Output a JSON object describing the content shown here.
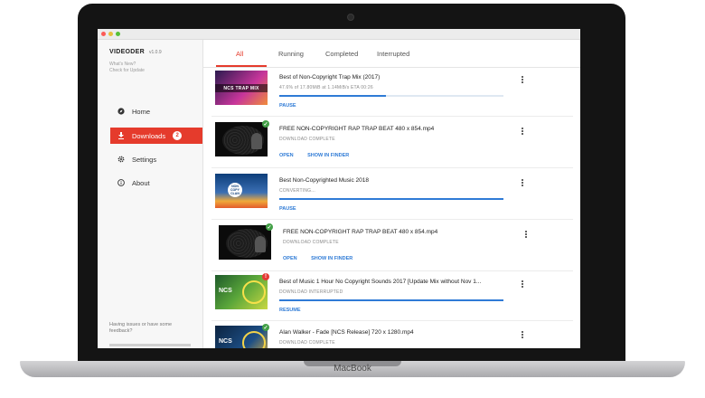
{
  "app": {
    "name": "VIDEODER",
    "version": "v1.0.9",
    "whats_new": "What's New?",
    "check_updates": "Check for Update"
  },
  "sidebar": {
    "items": [
      {
        "label": "Home",
        "icon": "compass-icon"
      },
      {
        "label": "Downloads",
        "icon": "download-icon",
        "badge": "2"
      },
      {
        "label": "Settings",
        "icon": "gear-icon"
      },
      {
        "label": "About",
        "icon": "info-icon"
      }
    ],
    "feedback": "Having issues or have some feedback?"
  },
  "tabs": [
    "All",
    "Running",
    "Completed",
    "Interrupted"
  ],
  "downloads": [
    {
      "title": "Best of Non-Copyright Trap Mix (2017)",
      "status": "47.6% of 17.80MiB at 1.14MiB/s ETA 00:26",
      "progress": 0.476,
      "actions": [
        "PAUSE"
      ],
      "thumb_text": "NCS TRAP MIX",
      "state": "running"
    },
    {
      "title": "FREE NON-COPYRIGHT RAP TRAP BEAT 480 x 854.mp4",
      "status": "DOWNLOAD COMPLETE",
      "actions": [
        "OPEN",
        "SHOW IN FINDER"
      ],
      "state": "complete"
    },
    {
      "title": "Best Non-Copyrighted Music 2018",
      "status": "CONVERTING...",
      "progress": 1.0,
      "actions": [
        "PAUSE"
      ],
      "thumb_text": "NON COPY CLAN",
      "state": "converting"
    },
    {
      "title": "FREE NON-COPYRIGHT RAP TRAP BEAT 480 x 854.mp4",
      "status": "DOWNLOAD COMPLETE",
      "actions": [
        "OPEN",
        "SHOW IN FINDER"
      ],
      "state": "complete"
    },
    {
      "title": "Best of Music 1 Hour No Copyright Sounds 2017 [Update Mix without Nov 1...",
      "status": "DOWNLOAD INTERRUPTED",
      "progress": 1.0,
      "actions": [
        "RESUME"
      ],
      "thumb_text": "NCS",
      "state": "interrupted"
    },
    {
      "title": "Alan Walker - Fade [NCS Release] 720 x 1280.mp4",
      "status": "DOWNLOAD COMPLETE",
      "actions": [],
      "thumb_text": "NCS",
      "state": "complete"
    }
  ],
  "device": {
    "brand": "MacBook"
  },
  "colors": {
    "accent": "#e53b2c",
    "link": "#2f7bd6",
    "ok": "#43a047",
    "error": "#e53935"
  }
}
